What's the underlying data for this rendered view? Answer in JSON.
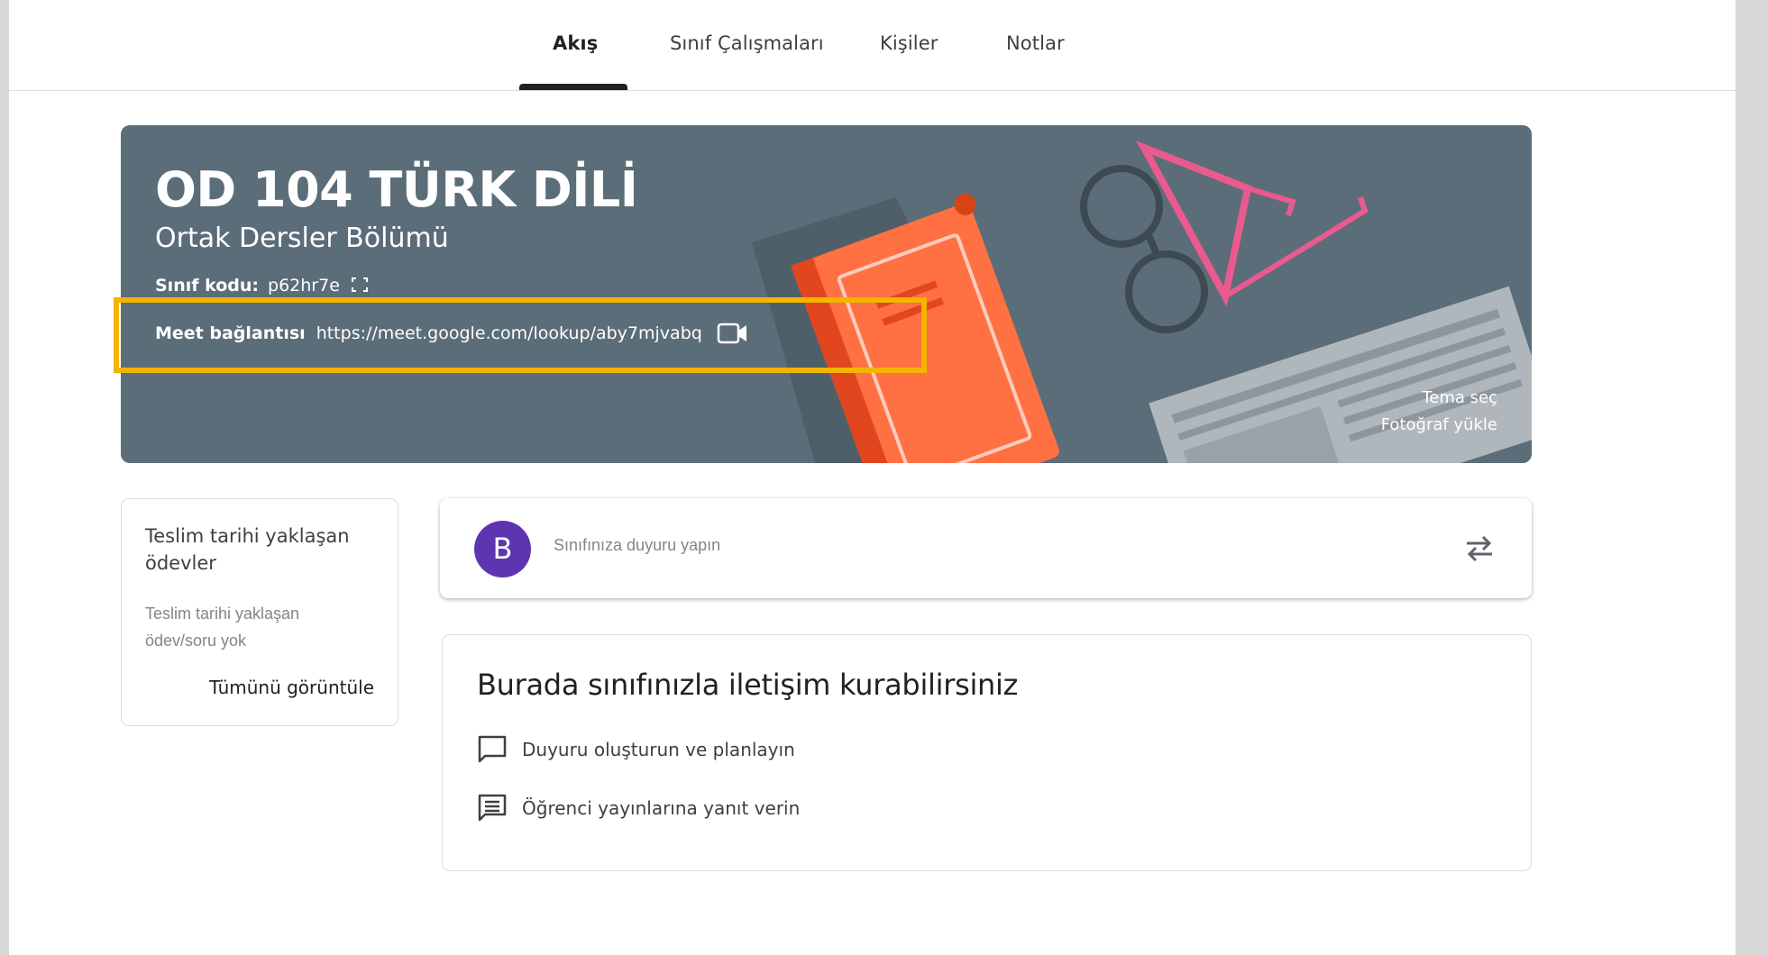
{
  "nav": {
    "tabs": [
      {
        "label": "Akış"
      },
      {
        "label": "Sınıf Çalışmaları"
      },
      {
        "label": "Kişiler"
      },
      {
        "label": "Notlar"
      }
    ]
  },
  "banner": {
    "title": "OD 104 TÜRK DİLİ",
    "subtitle": "Ortak Dersler Bölümü",
    "class_code_label": "Sınıf kodu:",
    "class_code": "p62hr7e",
    "meet_label": "Meet bağlantısı",
    "meet_url": "https://meet.google.com/lookup/aby7mjvabq",
    "theme_link": "Tema seç",
    "upload_link": "Fotoğraf yükle",
    "colors": {
      "background": "#5b6d78",
      "book": "#ff7043",
      "glasses": "#e95a8f",
      "highlight": "#f4b400"
    }
  },
  "upcoming": {
    "title": "Teslim tarihi yaklaşan ödevler",
    "empty_text": "Teslim tarihi yaklaşan ödev/soru yok",
    "view_all": "Tümünü görüntüle"
  },
  "announce": {
    "avatar_letter": "B",
    "placeholder": "Sınıfınıza duyuru yapın",
    "avatar_color": "#5e35b1"
  },
  "info": {
    "title": "Burada sınıfınızla iletişim kurabilirsiniz",
    "items": [
      {
        "label": "Duyuru oluşturun ve planlayın",
        "icon": "chat-bubble-icon"
      },
      {
        "label": "Öğrenci yayınlarına yanıt verin",
        "icon": "message-lines-icon"
      }
    ]
  }
}
